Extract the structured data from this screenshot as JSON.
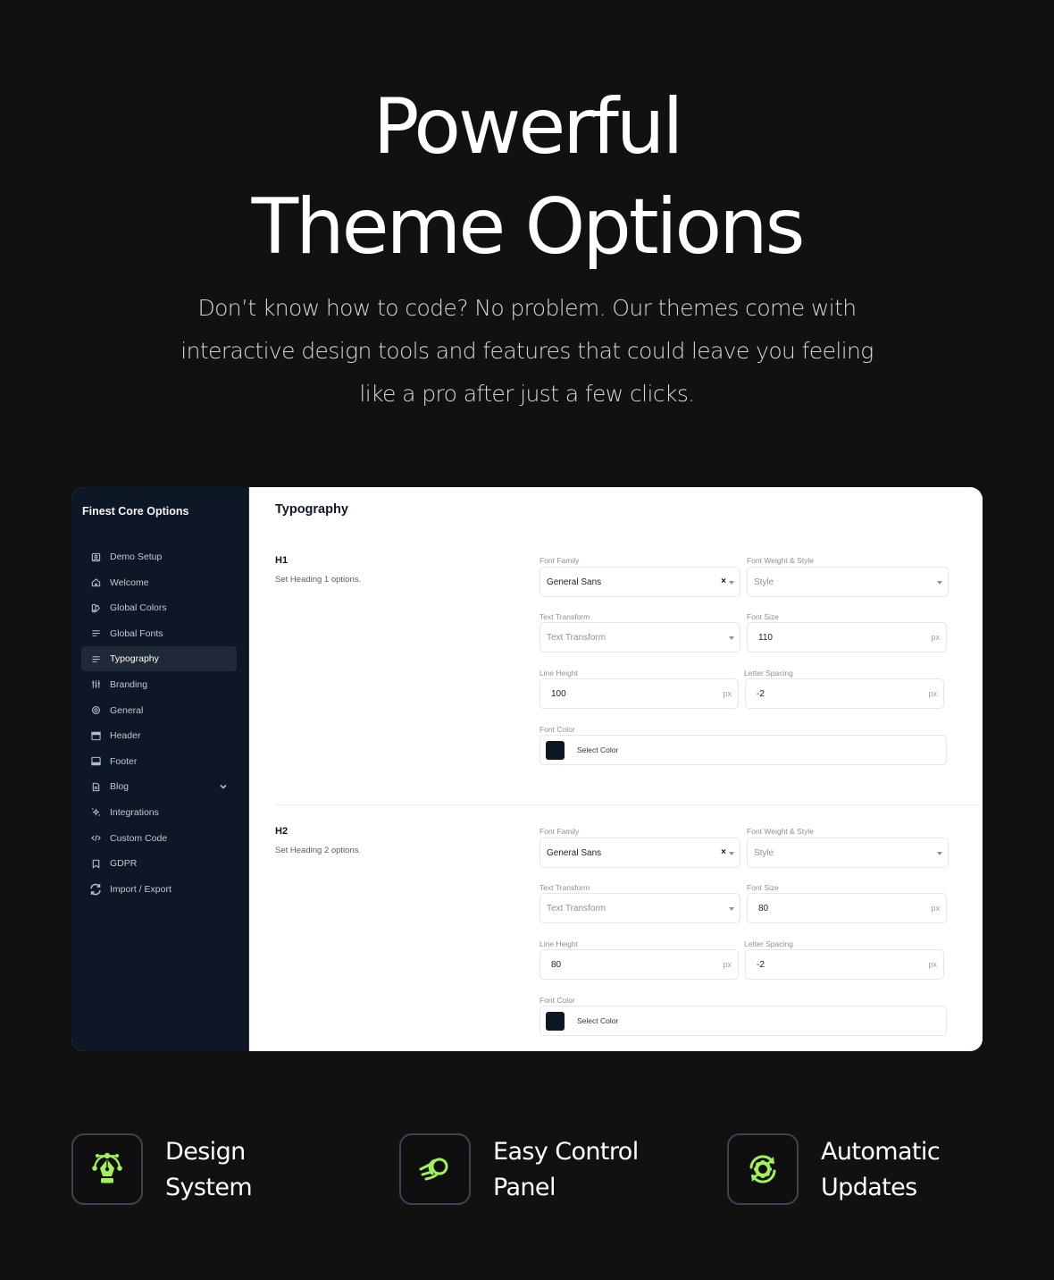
{
  "hero": {
    "title_line1": "Powerful",
    "title_line2": "Theme Options",
    "subtitle_line1": "Don’t know how to code? No problem. Our themes come with",
    "subtitle_line2": "interactive design tools and features that could leave you feeling",
    "subtitle_line3": "like a pro after just a few clicks."
  },
  "sidebar": {
    "title": "Finest Core Options",
    "items": [
      {
        "label": "Demo Setup",
        "icon": "demo-setup-icon"
      },
      {
        "label": "Welcome",
        "icon": "home-icon"
      },
      {
        "label": "Global Colors",
        "icon": "palette-icon"
      },
      {
        "label": "Global Fonts",
        "icon": "text-lines-icon"
      },
      {
        "label": "Typography",
        "icon": "text-lines-icon",
        "active": true
      },
      {
        "label": "Branding",
        "icon": "sliders-icon"
      },
      {
        "label": "General",
        "icon": "gear-icon"
      },
      {
        "label": "Header",
        "icon": "header-layout-icon"
      },
      {
        "label": "Footer",
        "icon": "footer-layout-icon"
      },
      {
        "label": "Blog",
        "icon": "document-icon",
        "expandable": true
      },
      {
        "label": "Integrations",
        "icon": "sparkle-icon"
      },
      {
        "label": "Custom Code",
        "icon": "code-icon"
      },
      {
        "label": "GDPR",
        "icon": "bookmark-icon"
      },
      {
        "label": "Import / Export",
        "icon": "sync-icon"
      }
    ]
  },
  "main": {
    "title": "Typography",
    "sections": [
      {
        "heading": "H1",
        "description": "Set Heading 1 options.",
        "font_family_label": "Font Family",
        "font_family_value": "General Sans",
        "font_weight_label": "Font Weight & Style",
        "font_weight_placeholder": "Style",
        "text_transform_label": "Text Transform",
        "text_transform_placeholder": "Text Transform",
        "font_size_label": "Font Size",
        "font_size_value": "110",
        "line_height_label": "Line Height",
        "line_height_value": "100",
        "letter_spacing_label": "Letter Spacing",
        "letter_spacing_value": "-2",
        "unit": "px",
        "font_color_label": "Font Color",
        "font_color_button": "Select Color",
        "font_color_value": "#0e1726"
      },
      {
        "heading": "H2",
        "description": "Set Heading 2 options.",
        "font_family_label": "Font Family",
        "font_family_value": "General Sans",
        "font_weight_label": "Font Weight & Style",
        "font_weight_placeholder": "Style",
        "text_transform_label": "Text Transform",
        "text_transform_placeholder": "Text Transform",
        "font_size_label": "Font Size",
        "font_size_value": "80",
        "line_height_label": "Line Height",
        "line_height_value": "80",
        "letter_spacing_label": "Letter Spacing",
        "letter_spacing_value": "-2",
        "unit": "px",
        "font_color_label": "Font Color",
        "font_color_button": "Select Color",
        "font_color_value": "#0e1726"
      }
    ]
  },
  "features": [
    {
      "line1": "Design",
      "line2": "System",
      "icon": "pen-tool-icon"
    },
    {
      "line1": "Easy Control",
      "line2": "Panel",
      "icon": "fast-ball-icon"
    },
    {
      "line1": "Automatic",
      "line2": "Updates",
      "icon": "gear-sync-icon"
    }
  ],
  "colors": {
    "background": "#111111",
    "sidebar": "#0e1726",
    "accent": "#a3f25b"
  }
}
